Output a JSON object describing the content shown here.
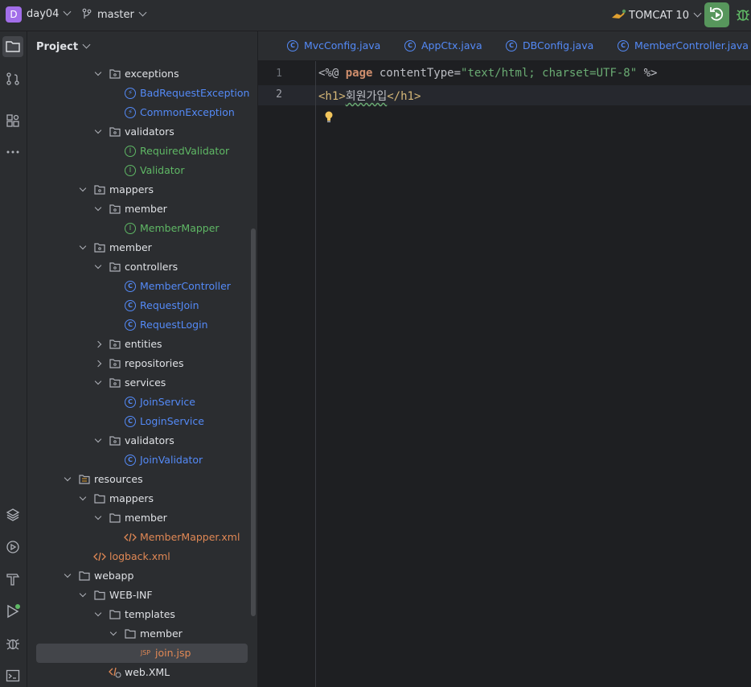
{
  "topbar": {
    "project_initial": "D",
    "project_name": "day04",
    "branch": "master",
    "run_config": "TOMCAT 10"
  },
  "panel": {
    "title": "Project"
  },
  "tree": [
    {
      "label": "exceptions",
      "type": "package",
      "depth": 4,
      "expanded": true
    },
    {
      "label": "BadRequestException",
      "type": "exception",
      "depth": 5
    },
    {
      "label": "CommonException",
      "type": "exception",
      "depth": 5
    },
    {
      "label": "validators",
      "type": "package",
      "depth": 4,
      "expanded": true
    },
    {
      "label": "RequiredValidator",
      "type": "interface",
      "depth": 5
    },
    {
      "label": "Validator",
      "type": "interface",
      "depth": 5
    },
    {
      "label": "mappers",
      "type": "package",
      "depth": 3,
      "expanded": true
    },
    {
      "label": "member",
      "type": "package",
      "depth": 4,
      "expanded": true
    },
    {
      "label": "MemberMapper",
      "type": "interface",
      "depth": 5
    },
    {
      "label": "member",
      "type": "package",
      "depth": 3,
      "expanded": true
    },
    {
      "label": "controllers",
      "type": "package",
      "depth": 4,
      "expanded": true
    },
    {
      "label": "MemberController",
      "type": "class",
      "depth": 5
    },
    {
      "label": "RequestJoin",
      "type": "class",
      "depth": 5
    },
    {
      "label": "RequestLogin",
      "type": "class",
      "depth": 5
    },
    {
      "label": "entities",
      "type": "package",
      "depth": 4,
      "expanded": false
    },
    {
      "label": "repositories",
      "type": "package",
      "depth": 4,
      "expanded": false
    },
    {
      "label": "services",
      "type": "package",
      "depth": 4,
      "expanded": true
    },
    {
      "label": "JoinService",
      "type": "class",
      "depth": 5
    },
    {
      "label": "LoginService",
      "type": "class",
      "depth": 5
    },
    {
      "label": "validators",
      "type": "package",
      "depth": 4,
      "expanded": true
    },
    {
      "label": "JoinValidator",
      "type": "class",
      "depth": 5
    },
    {
      "label": "resources",
      "type": "resfolder",
      "depth": 2,
      "expanded": true
    },
    {
      "label": "mappers",
      "type": "folder",
      "depth": 3,
      "expanded": true
    },
    {
      "label": "member",
      "type": "folder",
      "depth": 4,
      "expanded": true
    },
    {
      "label": "MemberMapper.xml",
      "type": "xml",
      "depth": 5
    },
    {
      "label": "logback.xml",
      "type": "xml",
      "depth": 3
    },
    {
      "label": "webapp",
      "type": "folder",
      "depth": 2,
      "expanded": true
    },
    {
      "label": "WEB-INF",
      "type": "folder",
      "depth": 3,
      "expanded": true
    },
    {
      "label": "templates",
      "type": "folder",
      "depth": 4,
      "expanded": true
    },
    {
      "label": "member",
      "type": "folder",
      "depth": 5,
      "expanded": true
    },
    {
      "label": "join.jsp",
      "type": "jsp",
      "depth": 6,
      "selected": true
    },
    {
      "label": "web.XML",
      "type": "webxml",
      "depth": 4
    }
  ],
  "tabs": [
    {
      "label": "MvcConfig.java"
    },
    {
      "label": "AppCtx.java"
    },
    {
      "label": "DBConfig.java"
    },
    {
      "label": "MemberController.java"
    }
  ],
  "editor": {
    "line_numbers": [
      "1",
      "2"
    ],
    "line1": {
      "open": "<%@ ",
      "keyword": "page",
      "attr": " contentType=",
      "value": "\"text/html; charset=UTF-8\"",
      "close": " %>"
    },
    "line2": {
      "open_tag": "<h1>",
      "text": "회원가입",
      "close_tag": "</h1>"
    }
  },
  "colors": {
    "accent_blue": "#548af7",
    "interface_green": "#5fb865",
    "xml_orange": "#e08855",
    "run_green": "#57965c",
    "project_badge": "#a26ee9"
  }
}
